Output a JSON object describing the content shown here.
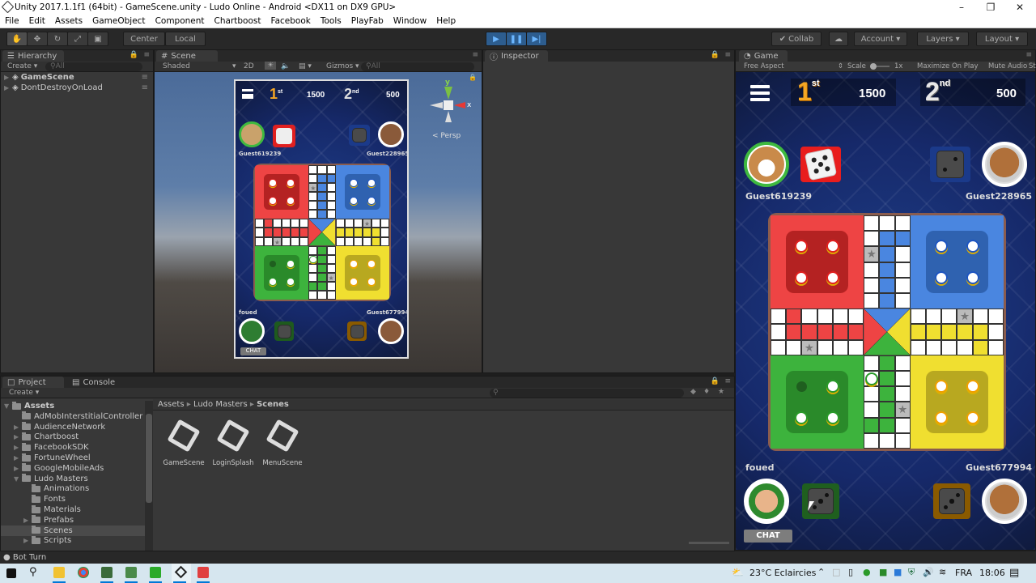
{
  "window": {
    "title": "Unity 2017.1.1f1 (64bit) - GameScene.unity - Ludo Online - Android <DX11 on DX9 GPU>",
    "controls": [
      "minimize",
      "maximize",
      "close"
    ]
  },
  "menubar": [
    "File",
    "Edit",
    "Assets",
    "GameObject",
    "Component",
    "Chartboost",
    "Facebook",
    "Tools",
    "PlayFab",
    "Window",
    "Help"
  ],
  "toolbar": {
    "transform_tools": [
      "hand-tool",
      "move-tool",
      "rotate-tool",
      "scale-tool",
      "rect-tool"
    ],
    "pivot": "Center",
    "space": "Local",
    "play_controls": [
      "play",
      "pause",
      "step"
    ],
    "collab": "Collab",
    "account": "Account",
    "layers": "Layers",
    "layout": "Layout",
    "play_state": "playing"
  },
  "hierarchy": {
    "tab": "Hierarchy",
    "create": "Create",
    "search_placeholder": "All",
    "items": [
      {
        "label": "GameScene"
      },
      {
        "label": "DontDestroyOnLoad"
      }
    ]
  },
  "scene": {
    "tab": "Scene",
    "shading": "Shaded",
    "mode_2d": "2D",
    "gizmos": "Gizmos",
    "search_placeholder": "All",
    "projection": "Persp",
    "gizmo_axes": {
      "x": "x",
      "y": "y"
    }
  },
  "inspector": {
    "tab": "Inspector"
  },
  "game": {
    "tab": "Game",
    "aspect": "Free Aspect",
    "scale_label": "Scale",
    "scale_value": "1x",
    "maximize_on_play": "Maximize On Play",
    "mute_audio": "Mute Audio",
    "stats": "Stats",
    "hud": {
      "rank1": {
        "label": "1",
        "suffix": "st",
        "score": "1500"
      },
      "rank2": {
        "label": "2",
        "suffix": "nd",
        "score": "500"
      }
    },
    "players": {
      "top_left": {
        "name": "Guest619239",
        "color": "#e53935",
        "dice_value": 5,
        "active": true
      },
      "top_right": {
        "name": "Guest228965",
        "color": "#1e3f8f",
        "dice_value": 2
      },
      "bottom_left": {
        "name": "foued",
        "color": "#2e7d32",
        "dice_value": 3
      },
      "bottom_right": {
        "name": "Guest677994",
        "color": "#b27400",
        "dice_value": 3
      }
    },
    "chat_button": "CHAT",
    "board_colors": {
      "red": "#ee4444",
      "blue": "#4a86e0",
      "green": "#3db33d",
      "yellow": "#f0df30"
    }
  },
  "project": {
    "tab": "Project",
    "console_tab": "Console",
    "create": "Create",
    "tree": [
      {
        "label": "Assets",
        "level": 0,
        "bold": true,
        "expanded": true
      },
      {
        "label": "AdMobInterstitialController",
        "level": 1
      },
      {
        "label": "AudienceNetwork",
        "level": 1,
        "collapsed": true
      },
      {
        "label": "Chartboost",
        "level": 1,
        "collapsed": true
      },
      {
        "label": "FacebookSDK",
        "level": 1,
        "collapsed": true
      },
      {
        "label": "FortuneWheel",
        "level": 1,
        "collapsed": true
      },
      {
        "label": "GoogleMobileAds",
        "level": 1,
        "collapsed": true
      },
      {
        "label": "Ludo Masters",
        "level": 1,
        "expanded": true
      },
      {
        "label": "Animations",
        "level": 2
      },
      {
        "label": "Fonts",
        "level": 2
      },
      {
        "label": "Materials",
        "level": 2
      },
      {
        "label": "Prefabs",
        "level": 2,
        "collapsed": true
      },
      {
        "label": "Scenes",
        "level": 2,
        "selected": true
      },
      {
        "label": "Scripts",
        "level": 2,
        "collapsed": true
      }
    ],
    "breadcrumb": [
      "Assets",
      "Ludo Masters",
      "Scenes"
    ],
    "assets": [
      {
        "label": "GameScene"
      },
      {
        "label": "LoginSplash"
      },
      {
        "label": "MenuScene"
      }
    ]
  },
  "statusbar": {
    "message": "Bot Turn"
  },
  "taskbar": {
    "weather": "23°C  Eclaircies",
    "language": "FRA",
    "time": "18:06"
  }
}
